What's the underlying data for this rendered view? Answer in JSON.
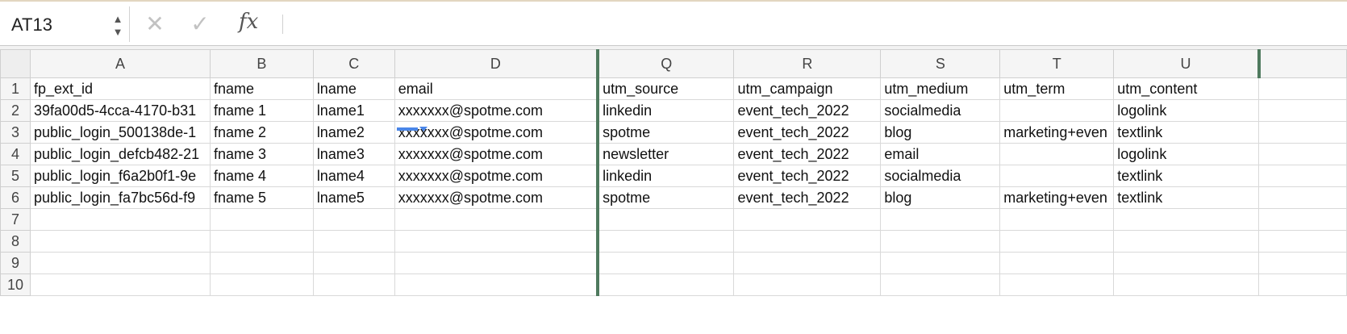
{
  "formula_bar": {
    "cell_ref": "AT13",
    "stepper_up": "▲",
    "stepper_down": "▼",
    "cancel_glyph": "✕",
    "accept_glyph": "✓",
    "fx_label": "fx",
    "value": ""
  },
  "columns": [
    "A",
    "B",
    "C",
    "D",
    "Q",
    "R",
    "S",
    "T",
    "U",
    ""
  ],
  "rows": [
    {
      "num": "1",
      "cells": [
        "fp_ext_id",
        "fname",
        "lname",
        "email",
        "utm_source",
        "utm_campaign",
        "utm_medium",
        "utm_term",
        "utm_content",
        ""
      ]
    },
    {
      "num": "2",
      "cells": [
        "39fa00d5-4cca-4170-b31",
        "fname 1",
        "lname1",
        "xxxxxxx@spotme.com",
        "linkedin",
        "event_tech_2022",
        "socialmedia",
        "",
        "logolink",
        ""
      ]
    },
    {
      "num": "3",
      "cells": [
        "public_login_500138de-1",
        "fname 2",
        "lname2",
        "xxxxxxx@spotme.com",
        "spotme",
        "event_tech_2022",
        "blog",
        "marketing+even",
        "textlink",
        ""
      ]
    },
    {
      "num": "4",
      "cells": [
        "public_login_defcb482-21",
        "fname 3",
        "lname3",
        "xxxxxxx@spotme.com",
        "newsletter",
        "event_tech_2022",
        "email",
        "",
        "logolink",
        ""
      ]
    },
    {
      "num": "5",
      "cells": [
        "public_login_f6a2b0f1-9e",
        "fname 4",
        "lname4",
        "xxxxxxx@spotme.com",
        "linkedin",
        "event_tech_2022",
        "socialmedia",
        "",
        "textlink",
        ""
      ]
    },
    {
      "num": "6",
      "cells": [
        "public_login_fa7bc56d-f9",
        "fname 5",
        "lname5",
        "xxxxxxx@spotme.com",
        "spotme",
        "event_tech_2022",
        "blog",
        "marketing+even",
        "textlink",
        ""
      ]
    },
    {
      "num": "7",
      "cells": [
        "",
        "",
        "",
        "",
        "",
        "",
        "",
        "",
        "",
        ""
      ]
    },
    {
      "num": "8",
      "cells": [
        "",
        "",
        "",
        "",
        "",
        "",
        "",
        "",
        "",
        ""
      ]
    },
    {
      "num": "9",
      "cells": [
        "",
        "",
        "",
        "",
        "",
        "",
        "",
        "",
        "",
        ""
      ]
    },
    {
      "num": "10",
      "cells": [
        "",
        "",
        "",
        "",
        "",
        "",
        "",
        "",
        "",
        ""
      ]
    }
  ],
  "colors": {
    "header_bg": "#f5f5f5",
    "hidden_column_marker": "#4f7a5e",
    "fill_handle": "#4a86e8"
  }
}
